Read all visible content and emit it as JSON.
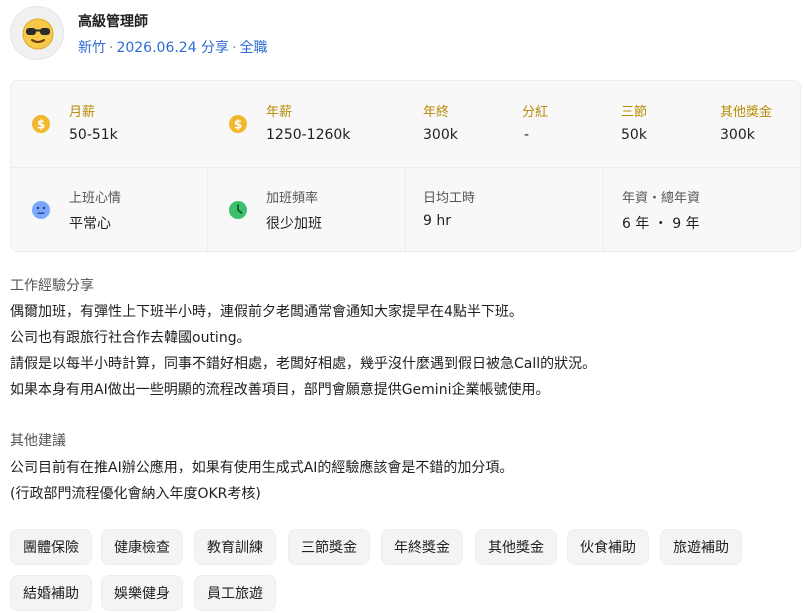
{
  "header": {
    "title": "高級管理師",
    "location": "新竹",
    "date": "2026.06.24 分享",
    "job_type": "全職"
  },
  "salary": {
    "monthly": {
      "label": "月薪",
      "value": "50-51k"
    },
    "annual": {
      "label": "年薪",
      "value": "1250-1260k"
    },
    "year_end": {
      "label": "年終",
      "value": "300k"
    },
    "dividend": {
      "label": "分紅",
      "value": "-"
    },
    "festival": {
      "label": "三節",
      "value": "50k"
    },
    "other": {
      "label": "其他獎金",
      "value": "300k"
    }
  },
  "work": {
    "mood": {
      "label": "上班心情",
      "value": "平常心"
    },
    "overtime": {
      "label": "加班頻率",
      "value": "很少加班"
    },
    "hours": {
      "label": "日均工時",
      "value": "9 hr"
    },
    "seniority": {
      "label": "年資・總年資",
      "value": "6 年 ・ 9 年"
    }
  },
  "experience": {
    "title": "工作經驗分享",
    "lines": [
      "偶爾加班，有彈性上下班半小時，連假前夕老闆通常會通知大家提早在4點半下班。",
      "公司也有跟旅行社合作去韓國outing。",
      "請假是以每半小時計算，同事不錯好相處，老闆好相處，幾乎沒什麼遇到假日被急Call的狀況。",
      "如果本身有用AI做出一些明顯的流程改善項目，部門會願意提供Gemini企業帳號使用。"
    ]
  },
  "advice": {
    "title": "其他建議",
    "lines": [
      "公司目前有在推AI辦公應用，如果有使用生成式AI的經驗應該會是不錯的加分項。",
      "(行政部門流程優化會納入年度OKR考核)"
    ]
  },
  "tags": [
    "團體保險",
    "健康檢查",
    "教育訓練",
    "三節獎金",
    "年終獎金",
    "其他獎金",
    "伙食補助",
    "旅遊補助",
    "結婚補助",
    "娛樂健身",
    "員工旅遊"
  ],
  "icons": {
    "avatar": "sunglasses-face-icon",
    "monthly": "coin-icon",
    "annual": "coin-icon",
    "mood": "neutral-face-icon",
    "overtime": "clock-icon"
  },
  "colors": {
    "link": "#2f6bd6",
    "gold_label": "#b78a06",
    "coin": "#f2b72c",
    "mood_face": "#7aa7ff",
    "clock": "#3bbf6a"
  }
}
